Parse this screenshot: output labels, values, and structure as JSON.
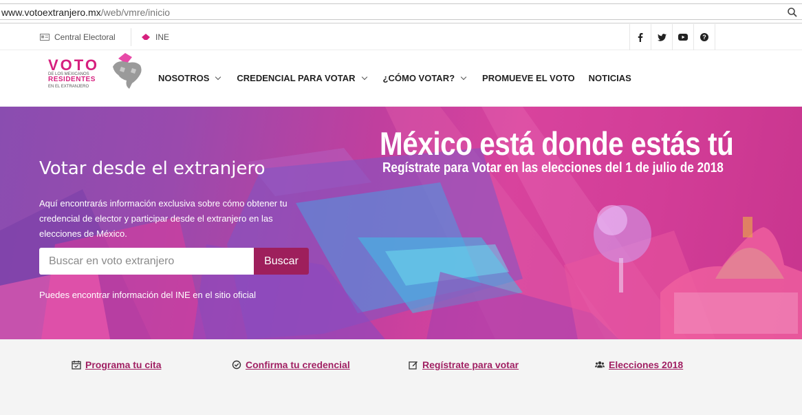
{
  "browser": {
    "url_domain": "www.votoextranjero.mx",
    "url_path": "/web/vmre/inicio"
  },
  "utility_bar": {
    "central_electoral": "Central Electoral",
    "ine": "INE",
    "social": [
      "f",
      "t",
      "yt",
      "?"
    ]
  },
  "logo": {
    "voto": "VOTO",
    "line1": "DE LOS MEXICANOS",
    "line2": "RESIDENTES",
    "line3": "EN EL EXTRANJERO"
  },
  "nav": {
    "items": [
      {
        "label": "NOSOTROS",
        "dropdown": true
      },
      {
        "label": "CREDENCIAL PARA VOTAR",
        "dropdown": true
      },
      {
        "label": "¿CÓMO VOTAR?",
        "dropdown": true
      },
      {
        "label": "PROMUEVE EL VOTO",
        "dropdown": false
      },
      {
        "label": "NOTICIAS",
        "dropdown": false
      }
    ]
  },
  "hero": {
    "headline": "México está donde estás tú",
    "subheadline": "Regístrate para Votar en las elecciones del 1 de julio de 2018",
    "title": "Votar desde el extranjero",
    "description": "Aquí encontrarás información exclusiva sobre cómo obtener tu credencial de elector y participar desde el extranjero en las elecciones de México.",
    "search_placeholder": "Buscar en voto extranjero",
    "search_button": "Buscar",
    "note": "Puedes encontrar información del INE en el sitio oficial"
  },
  "quick_links": [
    {
      "label": "Programa tu cita",
      "icon": "calendar-icon"
    },
    {
      "label": "Confirma tu credencial",
      "icon": "check-circle-icon"
    },
    {
      "label": "Regístrate para votar",
      "icon": "edit-icon"
    },
    {
      "label": "Elecciones 2018",
      "icon": "users-icon"
    }
  ],
  "colors": {
    "brand_pink": "#d6207e",
    "button": "#9e1f5c",
    "link": "#a01f62"
  }
}
